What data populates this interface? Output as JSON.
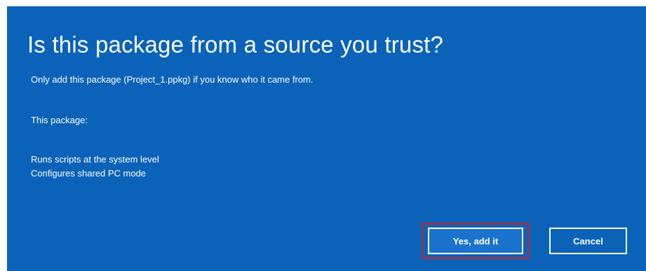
{
  "dialog": {
    "title": "Is this package from a source you trust?",
    "subtitle": "Only add this package (Project_1.ppkg) if you know who it came from.",
    "section_label": "This package:",
    "capabilities": [
      "Runs scripts at the system level",
      "Configures shared PC mode"
    ],
    "buttons": {
      "confirm_label": "Yes, add it",
      "cancel_label": "Cancel"
    }
  },
  "colors": {
    "dialog_background": "#0a63b8",
    "primary_button_background": "#1a73cc",
    "highlight_border": "#9b3150",
    "text": "#ffffff"
  }
}
